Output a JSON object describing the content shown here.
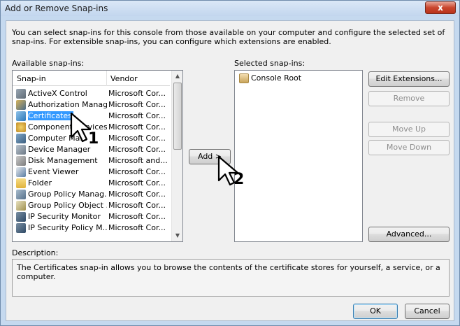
{
  "window": {
    "title": "Add or Remove Snap-ins",
    "close_label": "x",
    "intro": "You can select snap-ins for this console from those available on your computer and configure the selected set of snap-ins. For extensible snap-ins, you can configure which extensions are enabled."
  },
  "available": {
    "label": "Available snap-ins:",
    "columns": {
      "snapin": "Snap-in",
      "vendor": "Vendor"
    },
    "rows": [
      {
        "name": "ActiveX Control",
        "vendor": "Microsoft Cor...",
        "icon": "activex-icon"
      },
      {
        "name": "Authorization Manager",
        "vendor": "Microsoft Cor...",
        "icon": "authorization-icon"
      },
      {
        "name": "Certificates",
        "vendor": "Microsoft Cor...",
        "icon": "certificates-icon",
        "selected": true
      },
      {
        "name": "Component Services",
        "vendor": "Microsoft Cor...",
        "icon": "component-services-icon"
      },
      {
        "name": "Computer Ma...",
        "vendor": "Microsoft Cor...",
        "icon": "computer-management-icon"
      },
      {
        "name": "Device Manager",
        "vendor": "Microsoft Cor...",
        "icon": "device-manager-icon"
      },
      {
        "name": "Disk Management",
        "vendor": "Microsoft and...",
        "icon": "disk-management-icon"
      },
      {
        "name": "Event Viewer",
        "vendor": "Microsoft Cor...",
        "icon": "event-viewer-icon"
      },
      {
        "name": "Folder",
        "vendor": "Microsoft Cor...",
        "icon": "folder-icon"
      },
      {
        "name": "Group Policy Manag...",
        "vendor": "Microsoft Cor...",
        "icon": "group-policy-icon"
      },
      {
        "name": "Group Policy Object ...",
        "vendor": "Microsoft Cor...",
        "icon": "group-policy-object-icon"
      },
      {
        "name": "IP Security Monitor",
        "vendor": "Microsoft Cor...",
        "icon": "ip-security-icon"
      },
      {
        "name": "IP Security Policy M...",
        "vendor": "Microsoft Cor...",
        "icon": "ip-security-policy-icon"
      }
    ]
  },
  "add_button": "Add >",
  "selected": {
    "label": "Selected snap-ins:",
    "items": [
      {
        "name": "Console Root",
        "icon": "console-root-icon"
      }
    ]
  },
  "side_buttons": {
    "edit_extensions": "Edit Extensions...",
    "remove": "Remove",
    "move_up": "Move Up",
    "move_down": "Move Down",
    "advanced": "Advanced..."
  },
  "description": {
    "label": "Description:",
    "text": "The Certificates snap-in allows you to browse the contents of the certificate stores for yourself, a service, or a computer."
  },
  "footer": {
    "ok": "OK",
    "cancel": "Cancel"
  },
  "annotations": {
    "step1": "1",
    "step2": "2"
  }
}
